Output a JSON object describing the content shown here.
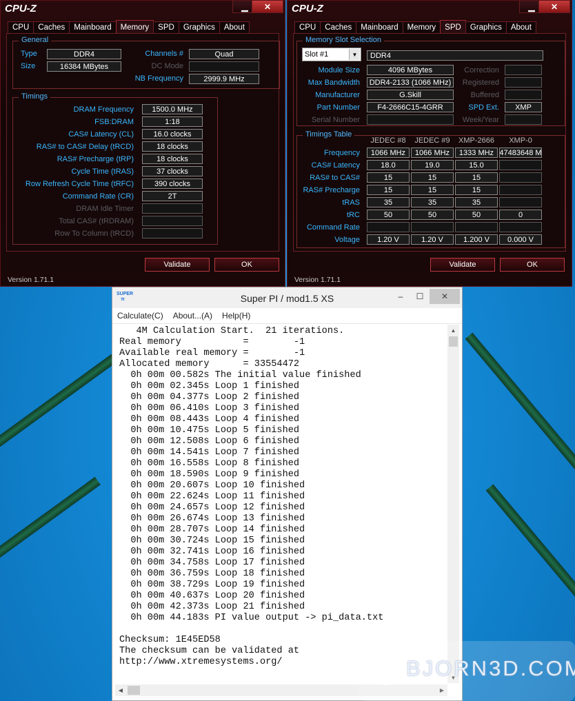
{
  "cpuz_left": {
    "title": "CPU-Z",
    "tabs": [
      "CPU",
      "Caches",
      "Mainboard",
      "Memory",
      "SPD",
      "Graphics",
      "About"
    ],
    "active_tab": "Memory",
    "general": {
      "title": "General",
      "type_label": "Type",
      "type_value": "DDR4",
      "size_label": "Size",
      "size_value": "16384 MBytes",
      "channels_label": "Channels #",
      "channels_value": "Quad",
      "dcmode_label": "DC Mode",
      "dcmode_value": "",
      "nbfreq_label": "NB Frequency",
      "nbfreq_value": "2999.9 MHz"
    },
    "timings": {
      "title": "Timings",
      "rows": [
        {
          "label": "DRAM Frequency",
          "value": "1500.0 MHz"
        },
        {
          "label": "FSB:DRAM",
          "value": "1:18"
        },
        {
          "label": "CAS# Latency (CL)",
          "value": "16.0 clocks"
        },
        {
          "label": "RAS# to CAS# Delay (tRCD)",
          "value": "18 clocks"
        },
        {
          "label": "RAS# Precharge (tRP)",
          "value": "18 clocks"
        },
        {
          "label": "Cycle Time (tRAS)",
          "value": "37 clocks"
        },
        {
          "label": "Row Refresh Cycle Time (tRFC)",
          "value": "390 clocks"
        },
        {
          "label": "Command Rate (CR)",
          "value": "2T"
        },
        {
          "label": "DRAM Idle Timer",
          "value": ""
        },
        {
          "label": "Total CAS# (tRDRAM)",
          "value": ""
        },
        {
          "label": "Row To Column (tRCD)",
          "value": ""
        }
      ]
    },
    "validate_label": "Validate",
    "ok_label": "OK",
    "version": "Version 1.71.1"
  },
  "cpuz_right": {
    "title": "CPU-Z",
    "tabs": [
      "CPU",
      "Caches",
      "Mainboard",
      "Memory",
      "SPD",
      "Graphics",
      "About"
    ],
    "active_tab": "SPD",
    "slot_group_title": "Memory Slot Selection",
    "slot_selected": "Slot #1",
    "slot_type": "DDR4",
    "left_fields": [
      {
        "label": "Module Size",
        "value": "4096 MBytes"
      },
      {
        "label": "Max Bandwidth",
        "value": "DDR4-2133 (1066 MHz)"
      },
      {
        "label": "Manufacturer",
        "value": "G.Skill"
      },
      {
        "label": "Part Number",
        "value": "F4-2666C15-4GRR"
      },
      {
        "label": "Serial Number",
        "value": ""
      }
    ],
    "right_fields": [
      {
        "label": "Correction",
        "value": ""
      },
      {
        "label": "Registered",
        "value": ""
      },
      {
        "label": "Buffered",
        "value": ""
      },
      {
        "label": "SPD Ext.",
        "value": "XMP"
      },
      {
        "label": "Week/Year",
        "value": ""
      }
    ],
    "timings_table": {
      "title": "Timings Table",
      "columns": [
        "JEDEC #8",
        "JEDEC #9",
        "XMP-2666",
        "XMP-0"
      ],
      "rows": [
        {
          "label": "Frequency",
          "cells": [
            "1066 MHz",
            "1066 MHz",
            "1333 MHz",
            "47483648 M"
          ]
        },
        {
          "label": "CAS# Latency",
          "cells": [
            "18.0",
            "19.0",
            "15.0",
            ""
          ]
        },
        {
          "label": "RAS# to CAS#",
          "cells": [
            "15",
            "15",
            "15",
            ""
          ]
        },
        {
          "label": "RAS# Precharge",
          "cells": [
            "15",
            "15",
            "15",
            ""
          ]
        },
        {
          "label": "tRAS",
          "cells": [
            "35",
            "35",
            "35",
            ""
          ]
        },
        {
          "label": "tRC",
          "cells": [
            "50",
            "50",
            "50",
            "0"
          ]
        },
        {
          "label": "Command Rate",
          "cells": [
            "",
            "",
            "",
            ""
          ]
        },
        {
          "label": "Voltage",
          "cells": [
            "1.20 V",
            "1.20 V",
            "1.200 V",
            "0.000 V"
          ]
        }
      ]
    },
    "validate_label": "Validate",
    "ok_label": "OK",
    "version": "Version 1.71.1"
  },
  "superpi": {
    "title": "Super PI / mod1.5 XS",
    "logo": "SUPER π",
    "menu": [
      "Calculate(C)",
      "About...(A)",
      "Help(H)"
    ],
    "lines": [
      "   4M Calculation Start.  21 iterations.",
      "Real memory           =        -1",
      "Available real memory =        -1",
      "Allocated memory      = 33554472",
      "  0h 00m 00.582s The initial value finished",
      "  0h 00m 02.345s Loop 1 finished",
      "  0h 00m 04.377s Loop 2 finished",
      "  0h 00m 06.410s Loop 3 finished",
      "  0h 00m 08.443s Loop 4 finished",
      "  0h 00m 10.475s Loop 5 finished",
      "  0h 00m 12.508s Loop 6 finished",
      "  0h 00m 14.541s Loop 7 finished",
      "  0h 00m 16.558s Loop 8 finished",
      "  0h 00m 18.590s Loop 9 finished",
      "  0h 00m 20.607s Loop 10 finished",
      "  0h 00m 22.624s Loop 11 finished",
      "  0h 00m 24.657s Loop 12 finished",
      "  0h 00m 26.674s Loop 13 finished",
      "  0h 00m 28.707s Loop 14 finished",
      "  0h 00m 30.724s Loop 15 finished",
      "  0h 00m 32.741s Loop 16 finished",
      "  0h 00m 34.758s Loop 17 finished",
      "  0h 00m 36.759s Loop 18 finished",
      "  0h 00m 38.729s Loop 19 finished",
      "  0h 00m 40.637s Loop 20 finished",
      "  0h 00m 42.373s Loop 21 finished",
      "  0h 00m 44.183s PI value output -> pi_data.txt",
      "",
      "Checksum: 1E45ED58",
      "The checksum can be validated at",
      "http://www.xtremesystems.org/"
    ]
  },
  "watermark": {
    "text": "BJORN3D.COM"
  },
  "colors": {
    "cpuz_accent": "#39b6ff",
    "cpuz_border": "#7d1c22",
    "desktop": "#1489d6"
  }
}
